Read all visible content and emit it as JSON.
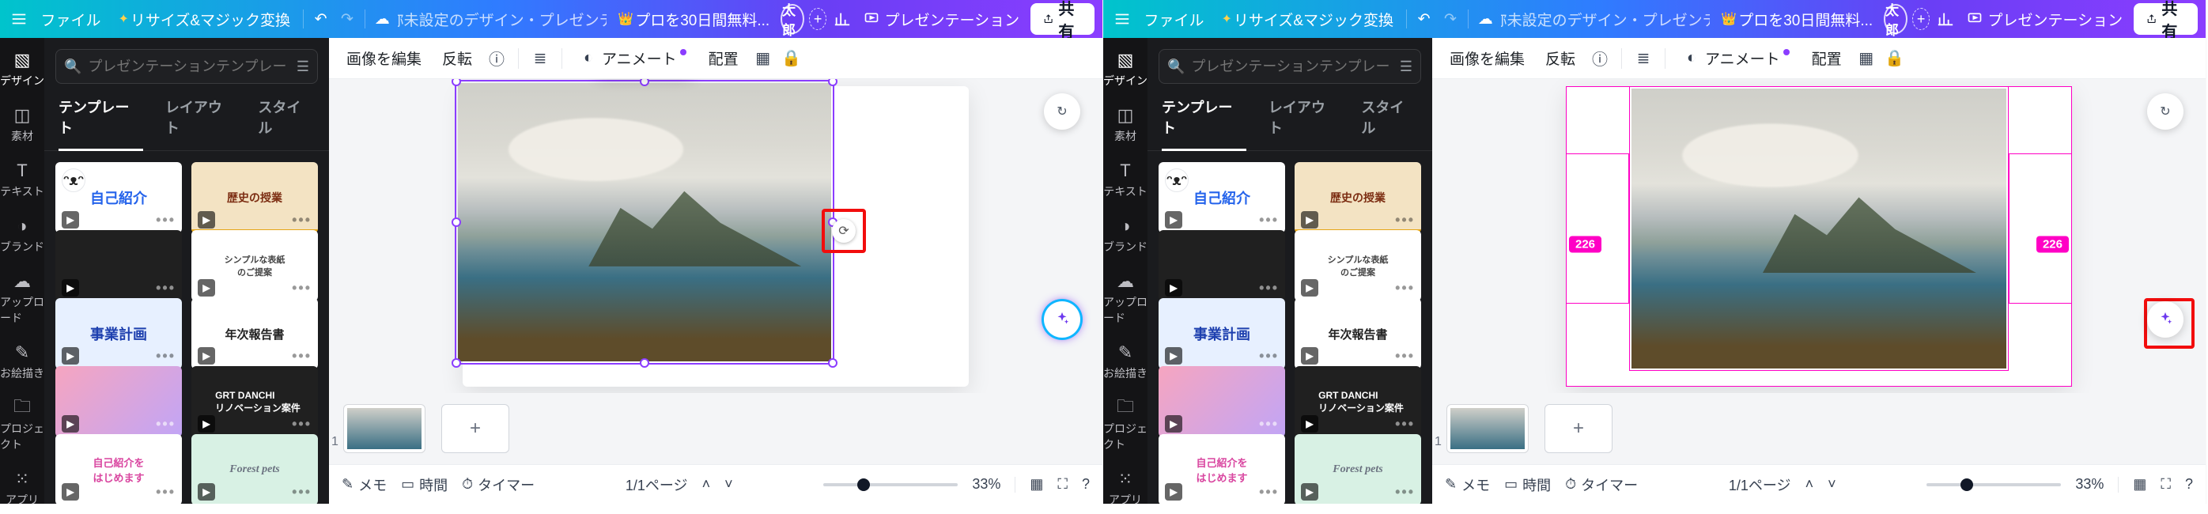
{
  "topbar": {
    "file": "ファイル",
    "resize_magic": "リサイズ&マジック変換",
    "doc_title": "名称未設定のデザイン・プレゼンテ ...",
    "pro_trial": "プロを30日間無料...",
    "avatar": "太郎",
    "present": "プレゼンテーション",
    "share": "共有"
  },
  "rail": {
    "items": [
      {
        "label": "デザイン"
      },
      {
        "label": "素材"
      },
      {
        "label": "テキスト"
      },
      {
        "label": "ブランド"
      },
      {
        "label": "アップロード"
      },
      {
        "label": "お絵描き"
      },
      {
        "label": "プロジェクト"
      },
      {
        "label": "アプリ"
      }
    ]
  },
  "sidepanel": {
    "search_placeholder": "プレゼンテーションテンプレートを検索",
    "tabs": {
      "templates": "テンプレート",
      "layouts": "レイアウト",
      "styles": "スタイル"
    },
    "tpls": [
      {
        "label": "自己紹介"
      },
      {
        "label": "歴史の授業"
      },
      {
        "label": ""
      },
      {
        "label": "シンプルな表紙\nのご提案"
      },
      {
        "label": "事業計画"
      },
      {
        "label": "年次報告書"
      },
      {
        "label": ""
      },
      {
        "label": "GRT DANCHI\nリノベーション案件"
      },
      {
        "label": "自己紹介を\nはじめます"
      },
      {
        "label": "Forest pets"
      }
    ]
  },
  "toolbar": {
    "edit_image": "画像を編集",
    "flip": "反転",
    "animate": "アニメート",
    "position": "配置"
  },
  "measurements": {
    "left": "226",
    "right": "226"
  },
  "thumbs": {
    "index": "1"
  },
  "bottombar": {
    "notes": "メモ",
    "duration": "時間",
    "timer": "タイマー",
    "pages": "1/1ページ",
    "zoom": "33%"
  }
}
